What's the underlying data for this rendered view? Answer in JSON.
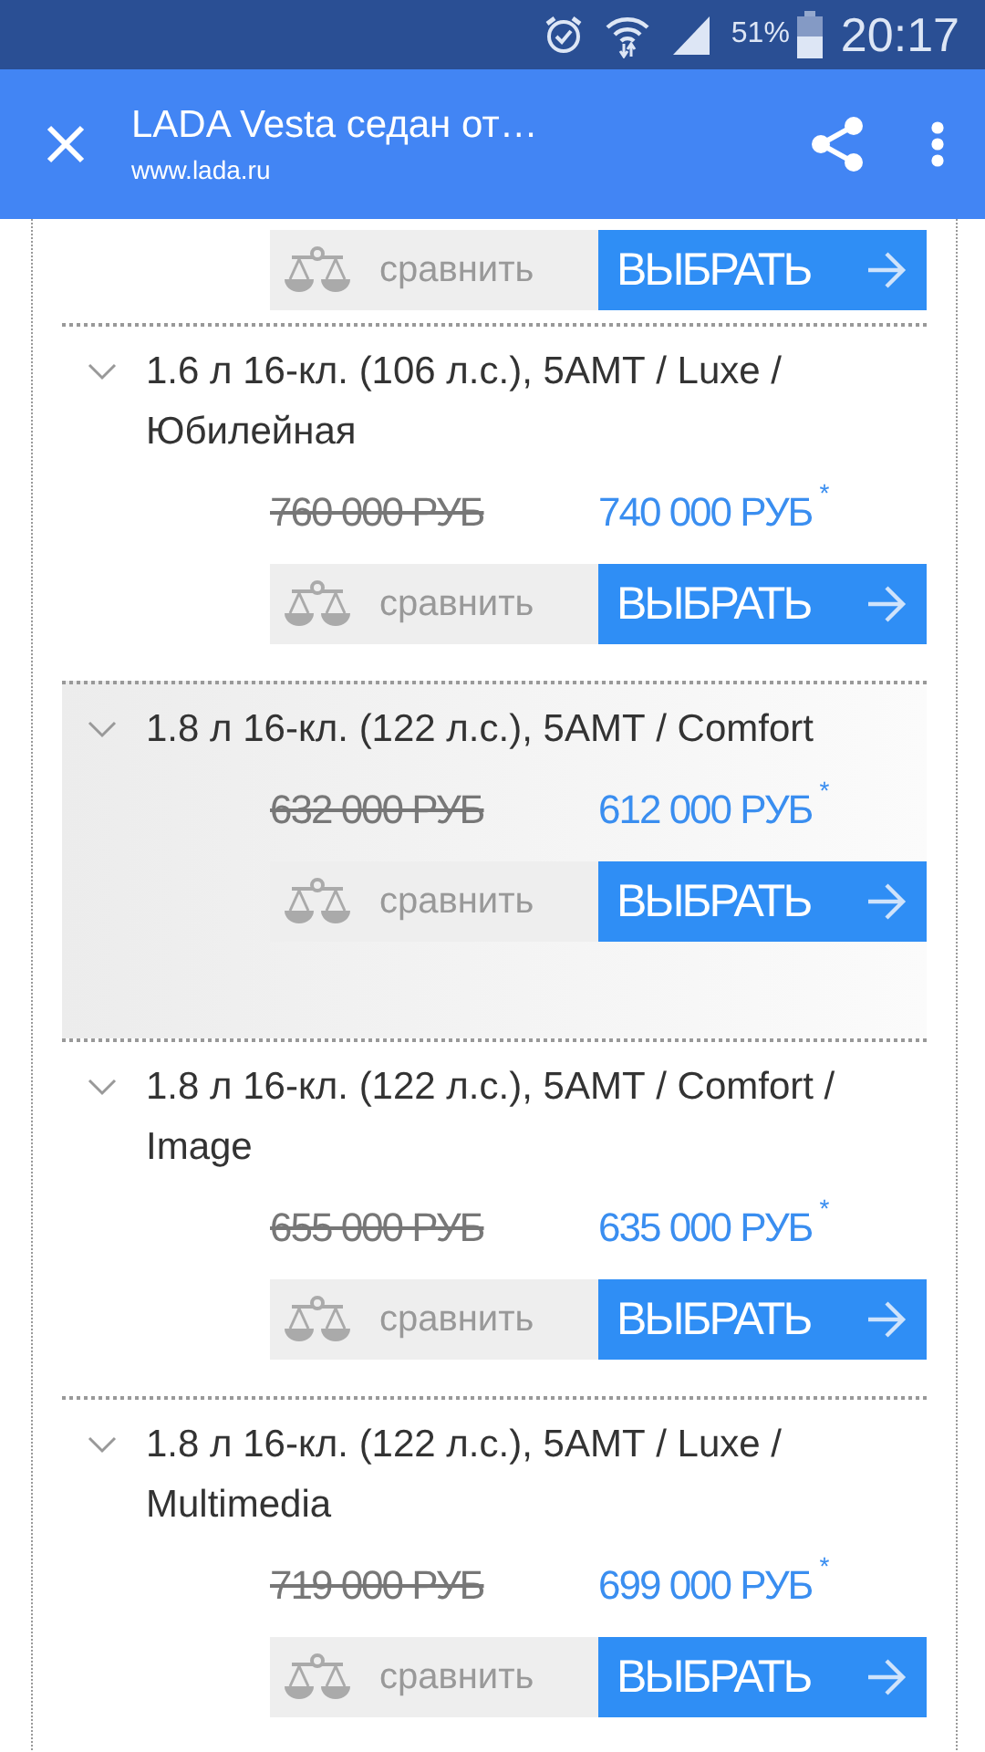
{
  "status_bar": {
    "battery": "51%",
    "time": "20:17"
  },
  "toolbar": {
    "title": "LADA Vesta седан от…",
    "url": "www.lada.ru"
  },
  "top_actions": {
    "compare_label": "сравнить",
    "select_label": "ВЫБРАТЬ"
  },
  "items": [
    {
      "title": "1.6 л 16-кл. (106 л.с.), 5АМТ / Luxe / Юбилейная",
      "old_price": "760 000 РУБ",
      "new_price": "740 000 РУБ",
      "note_mark": "*",
      "compare_label": "сравнить",
      "select_label": "ВЫБРАТЬ",
      "highlighted": false
    },
    {
      "title": "1.8 л 16-кл. (122 л.с.), 5АМТ / Comfort",
      "old_price": "632 000 РУБ",
      "new_price": "612 000 РУБ",
      "note_mark": "*",
      "compare_label": "сравнить",
      "select_label": "ВЫБРАТЬ",
      "highlighted": true
    },
    {
      "title": "1.8 л 16-кл. (122 л.с.), 5АМТ / Comfort / Image",
      "old_price": "655 000 РУБ",
      "new_price": "635 000 РУБ",
      "note_mark": "*",
      "compare_label": "сравнить",
      "select_label": "ВЫБРАТЬ",
      "highlighted": false
    },
    {
      "title": "1.8 л 16-кл. (122 л.с.), 5АМТ / Luxe / Multimedia",
      "old_price": "719 000 РУБ",
      "new_price": "699 000 РУБ",
      "note_mark": "*",
      "compare_label": "сравнить",
      "select_label": "ВЫБРАТЬ",
      "highlighted": false
    }
  ]
}
